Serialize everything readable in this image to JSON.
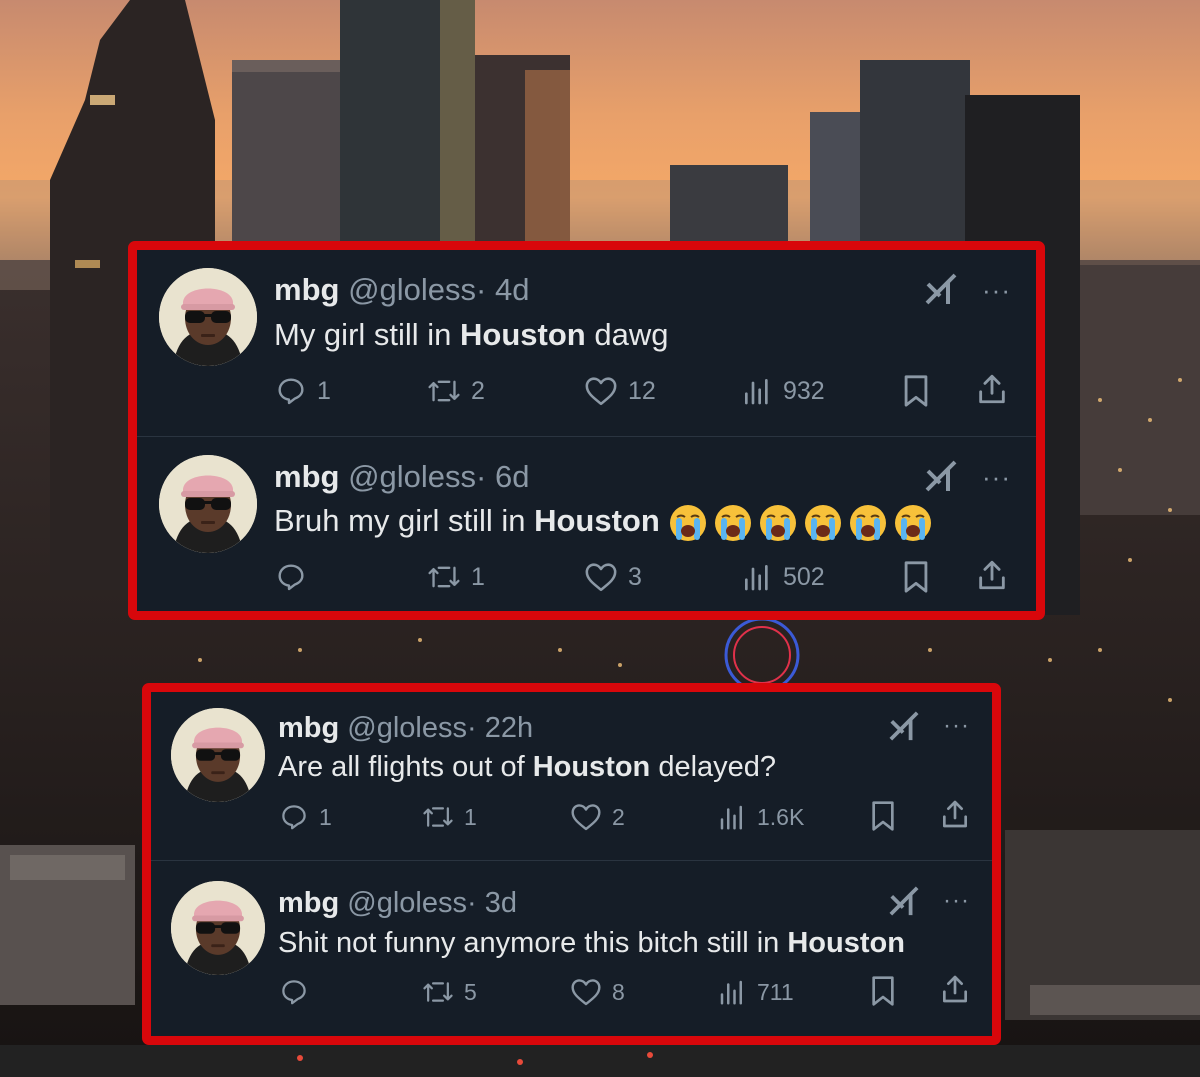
{
  "panels": [
    {
      "tweets": [
        {
          "name": "mbg",
          "handle": "@gloless",
          "time": "· 4d",
          "text_before": "My girl still in ",
          "text_bold": "Houston",
          "text_after": " dawg",
          "replies": "1",
          "reposts": "2",
          "likes": "12",
          "views": "932"
        },
        {
          "name": "mbg",
          "handle": "@gloless",
          "time": "· 6d",
          "text_before": "Bruh my girl still in ",
          "text_bold": "Houston",
          "text_after": "",
          "emoji": [
            "loudly-crying-face",
            "loudly-crying-face",
            "loudly-crying-face",
            "loudly-crying-face",
            "loudly-crying-face",
            "loudly-crying-face"
          ],
          "replies": "",
          "reposts": "1",
          "likes": "3",
          "views": "502"
        }
      ]
    },
    {
      "tweets": [
        {
          "name": "mbg",
          "handle": "@gloless",
          "time": "· 22h",
          "text_before": "Are all flights out of ",
          "text_bold": "Houston",
          "text_after": " delayed?",
          "replies": "1",
          "reposts": "1",
          "likes": "2",
          "views": "1.6K"
        },
        {
          "name": "mbg",
          "handle": "@gloless",
          "time": "· 3d",
          "text_before": "Shit not funny anymore this bitch still in ",
          "text_bold": "Houston",
          "text_after": "",
          "replies": "",
          "reposts": "5",
          "likes": "8",
          "views": "711"
        }
      ]
    }
  ],
  "more_glyph": "···",
  "icons": [
    "grok-icon",
    "more-icon",
    "reply-icon",
    "repost-icon",
    "like-icon",
    "views-icon",
    "bookmark-icon",
    "share-icon"
  ],
  "colors": {
    "panel_border": "#d8070b",
    "panel_bg": "#151d27",
    "text": "#e7e9ea",
    "muted": "#8b98a5"
  }
}
